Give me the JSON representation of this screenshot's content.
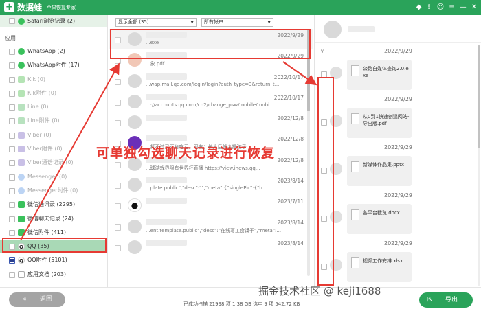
{
  "app": {
    "title": "数据蛙",
    "subtitle": "苹果恢复专家"
  },
  "sidebar": {
    "top_item": "Safari浏览记录 (2)",
    "section_label": "应用",
    "items": [
      {
        "label": "WhatsApp (2)",
        "icon": "whatsapp-icon"
      },
      {
        "label": "WhatsApp附件 (17)",
        "icon": "whatsapp-icon"
      },
      {
        "label": "Kik (0)",
        "icon": "kik-icon"
      },
      {
        "label": "Kik附件 (0)",
        "icon": "kik-icon"
      },
      {
        "label": "Line (0)",
        "icon": "line-icon"
      },
      {
        "label": "Line附件 (0)",
        "icon": "line-icon"
      },
      {
        "label": "Viber (0)",
        "icon": "viber-icon"
      },
      {
        "label": "Viber附件 (0)",
        "icon": "viber-icon"
      },
      {
        "label": "Viber通话记录 (0)",
        "icon": "viber-icon"
      },
      {
        "label": "Messenger (0)",
        "icon": "messenger-icon"
      },
      {
        "label": "Messenger附件 (0)",
        "icon": "messenger-icon"
      },
      {
        "label": "微信通讯录 (2295)",
        "icon": "wechat-icon"
      },
      {
        "label": "微信聊天记录 (24)",
        "icon": "wechat-icon"
      },
      {
        "label": "微信附件 (411)",
        "icon": "wechat-icon"
      },
      {
        "label": "QQ (35)",
        "icon": "qq-icon"
      },
      {
        "label": "QQ附件 (5101)",
        "icon": "qq-icon"
      },
      {
        "label": "应用文档 (203)",
        "icon": "document-icon"
      }
    ],
    "back_label": "返回"
  },
  "filters": {
    "show": "显示全部 (35)",
    "account": "所有帐户"
  },
  "messages": [
    {
      "date": "2022/9/29",
      "snippet": "...exe"
    },
    {
      "date": "2022/9/29",
      "snippet": "...象.pdf"
    },
    {
      "date": "2022/10/17",
      "snippet": "...wap.mail.qq.com/login/login?auth_type=3&return_t..."
    },
    {
      "date": "2022/10/17",
      "snippet": "...://accounts.qq.com/cn2/change_psw/mobile/mobi..."
    },
    {
      "date": "2022/12/8",
      "snippet": ""
    },
    {
      "date": "2022/12/8",
      "snippet": "...打不过又不肯吃亏。网友：长大后就会挑孩子"
    },
    {
      "date": "2022/12/8",
      "snippet": "...球游戏界限有世界杯直播 https://view.inews.qq..."
    },
    {
      "date": "2023/8/14",
      "snippet": "...plate.public\",\"desc\":\"\",\"meta\":{\"singlePic\":{\"b..."
    },
    {
      "date": "2023/7/11",
      "snippet": ""
    },
    {
      "date": "2023/8/14",
      "snippet": "...ent.template.public\",\"desc\":\"在线写工食馍子\",\"meta\":..."
    },
    {
      "date": "2023/8/14",
      "snippet": ""
    }
  ],
  "detail": {
    "dates": [
      "2022/9/29",
      "2022/9/29",
      "2022/9/29",
      "2022/9/29",
      "2022/9/29"
    ],
    "files": [
      "公路自媒体查询2.0.exe",
      "从0到1快速创建网站-导出版.pdf",
      "新媒体作品集.pptx",
      "各平台截览.docx",
      "视频工作安排.xlsx"
    ]
  },
  "annotation": "可单独勾选聊天记录进行恢复",
  "status": "已成功扫描 21998 项 1.38 GB  选中 9 项 542.72 KB",
  "export_label": "导出",
  "watermark": "掘金技术社区 @ keji1688",
  "colors": {
    "brand": "#2aa35a",
    "annotation": "#e63a33",
    "selected": "#a9d9b6"
  }
}
